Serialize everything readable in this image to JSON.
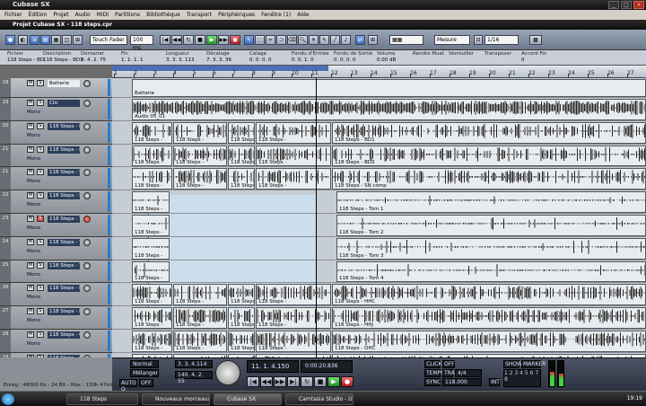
{
  "window": {
    "title": "Cubase SX",
    "controls": [
      "_",
      "□",
      "×"
    ]
  },
  "menu": [
    "Fichier",
    "Édition",
    "Projet",
    "Audio",
    "MIDI",
    "Partitions",
    "Bibliothèque",
    "Transport",
    "Périphériques",
    "Fenêtre (1)",
    "Aide"
  ],
  "project": {
    "title": "Projet Cubase SX - 118 steps.cpr"
  },
  "toolbar": {
    "automation_mode": "Touch Fader",
    "preroll": "100 ms",
    "snap": "Mesure",
    "quantize": "1/16"
  },
  "infoline": {
    "headers": [
      "Fichier",
      "Description",
      "Démarrer",
      "Fin",
      "Longueur",
      "Décalage",
      "Calage",
      "Fondu d'Entrée",
      "Fondu de Sortie",
      "Volume",
      "Rendre Muet",
      "Verrouiller",
      "Transposer",
      "Accord Fin"
    ],
    "values": [
      "118 Steps - BD",
      "118 Steps - BD1",
      "9. 4. 2. 75",
      "1. 1. 1. 1",
      "3. 3. 3. 113",
      "7. 3. 3. 36",
      "0. 0. 0. 0",
      "0. 0. 1. 0",
      "0. 0. 0. 0",
      "0.00 dB",
      "",
      "",
      "",
      "0"
    ]
  },
  "ruler": {
    "numbers": [
      "1",
      "2",
      "3",
      "4",
      "5",
      "6",
      "7",
      "8",
      "9",
      "10",
      "11",
      "12",
      "13",
      "14",
      "15",
      "16",
      "17",
      "18",
      "19",
      "20",
      "21",
      "22",
      "23",
      "24",
      "25",
      "26",
      "27"
    ]
  },
  "tracks": [
    {
      "num": "18",
      "name": "Batterie",
      "sub": "",
      "type": "folder"
    },
    {
      "num": "19",
      "name": "Clic",
      "sub": "Mono"
    },
    {
      "num": "20",
      "name": "118 Steps - BD",
      "sub": "Mono"
    },
    {
      "num": "21",
      "name": "118 Steps - BD",
      "sub": "Mono"
    },
    {
      "num": "21",
      "name": "118 Steps - SN",
      "sub": "Mono"
    },
    {
      "num": "22",
      "name": "118 Steps - SN",
      "sub": "Mono"
    },
    {
      "num": "23",
      "name": "118 Steps - Tom",
      "sub": "Mono"
    },
    {
      "num": "24",
      "name": "118 Steps - Tom",
      "sub": "Mono"
    },
    {
      "num": "25",
      "name": "118 Steps - Tom",
      "sub": "Mono"
    },
    {
      "num": "26",
      "name": "118 Steps - HH",
      "sub": "Mono"
    },
    {
      "num": "27",
      "name": "118 Steps - HH",
      "sub": "Mono"
    },
    {
      "num": "28",
      "name": "118 Steps - OH",
      "sub": "Mono"
    },
    {
      "num": "29",
      "name": "118 Steps - OH",
      "sub": "Mono"
    }
  ],
  "events": {
    "folder": "Batterie",
    "clic": "Audio 05_01",
    "bd1": "118 Steps - BD1",
    "bd2": "118 Steps - BD2",
    "sncomp": "118 Steps - SN comp",
    "tom1": "118 Steps - Tom 1",
    "tom2": "118 Steps - Tom 2",
    "tom3": "118 Steps - Tom 3",
    "tom4": "118 Steps - Tom 4",
    "hhc": "118 Steps - HHC",
    "hhj": "118 Steps - HHJ",
    "ohc": "118 Steps - OHC",
    "short": "118 Steps -"
  },
  "transport": {
    "mode1": "Normal",
    "mode2": "Mélanger",
    "auto_q": "AUTO Q",
    "off": "OFF",
    "left_locator": "3. 3. 4.114",
    "right_locator": "140. 4. 2. 55",
    "position": "11. 1. 4.150",
    "time": "0:00:20.836",
    "click": "CLICK",
    "click_val": "OFF",
    "tempo": "TEMPO",
    "track_label": "TRACK",
    "signature": "4/4",
    "tempo_value": "118.000",
    "sync": "SYNC",
    "sync_val": "INT",
    "show": "SHOW",
    "marker": "MARKER"
  },
  "status": {
    "rec": "Enreg : 48000 Hz - 24 Bit - Max : 130h 47min"
  },
  "taskbar": {
    "items": [
      "118 Steps",
      "Nouveaux morceaux",
      "Cubase SX",
      "Camtasia Studio - Untit..."
    ],
    "clock": "19:19"
  }
}
